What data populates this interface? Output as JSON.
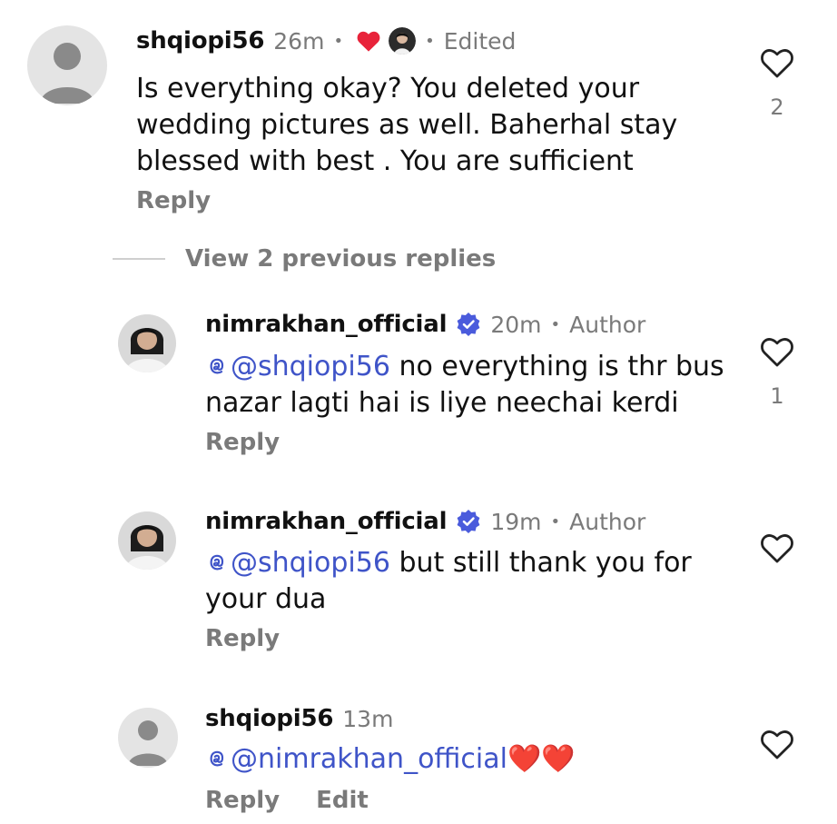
{
  "comments": [
    {
      "username": "shqiopi56",
      "time": "26m",
      "edited": "Edited",
      "text": "Is everything okay? You deleted your wedding pictures as well. Baherhal stay blessed with best . You are sufficient",
      "reply": "Reply",
      "likes": "2"
    },
    {
      "username": "nimrakhan_official",
      "time": "20m",
      "role": "Author",
      "mention": "@shqiopi56",
      "text": " no everything is thr bus nazar lagti hai is liye neechai kerdi",
      "reply": "Reply",
      "likes": "1"
    },
    {
      "username": "nimrakhan_official",
      "time": "19m",
      "role": "Author",
      "mention": "@shqiopi56",
      "text": " but still thank you for your dua",
      "reply": "Reply"
    },
    {
      "username": "shqiopi56",
      "time": "13m",
      "mention": "@nimrakhan_official",
      "text": "❤️❤️",
      "reply": "Reply",
      "edit": "Edit"
    }
  ],
  "view_previous": "View 2 previous replies",
  "icons": {
    "like": "heart-outline-icon",
    "liked": "heart-filled-icon",
    "verified": "verified-badge-icon",
    "mention": "threads-at-icon"
  },
  "colors": {
    "mention": "#3f54c8",
    "verified": "#4a5bdc",
    "heart": "#e8233a",
    "muted": "#7a7a7a"
  }
}
